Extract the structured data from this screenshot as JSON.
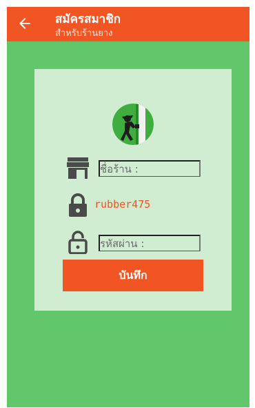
{
  "header": {
    "title": "สมัครสมาชิก",
    "subtitle": "สำหรับร้านยาง",
    "back_icon": "arrow-left-icon",
    "color": "#f05523"
  },
  "form": {
    "shop_name_placeholder": "ชื่อร้าน :",
    "username_value": "rubber475",
    "password_placeholder": "รหัสผ่าน :",
    "save_label": "บันทึก"
  },
  "icons": {
    "logo": "rubber-tapper-logo-icon",
    "shop": "store-icon",
    "user": "lock-icon",
    "password": "unlock-icon"
  },
  "colors": {
    "background": "#62c76a",
    "card": "#d0edd1",
    "accent": "#f05523"
  }
}
